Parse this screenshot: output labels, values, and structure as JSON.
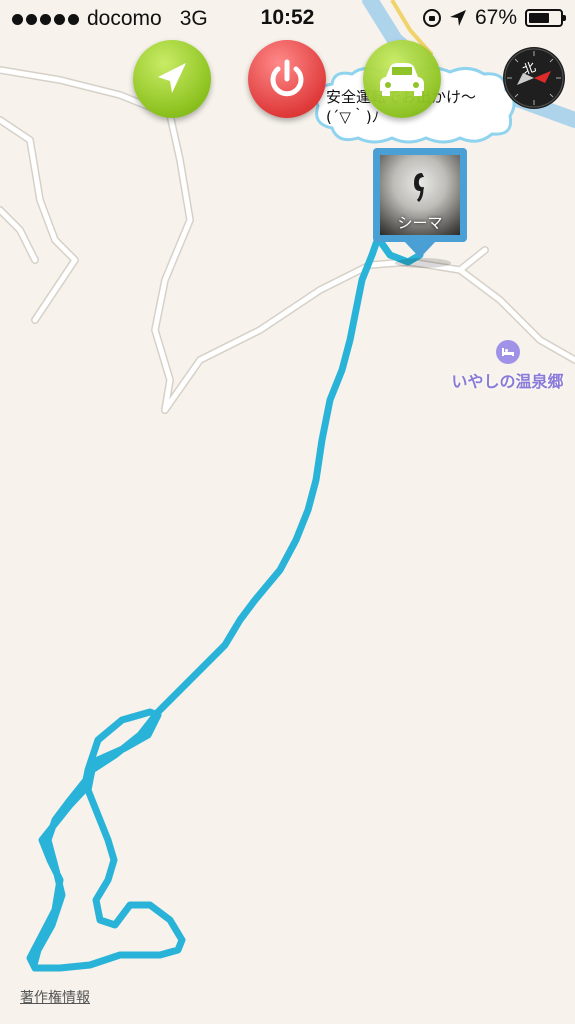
{
  "status_bar": {
    "carrier": "docomo",
    "network": "3G",
    "time": "10:52",
    "battery": "67%",
    "battery_level": 0.67,
    "icons": [
      "signal-dots-icon",
      "rotation-lock-icon",
      "location-arrow-icon",
      "battery-icon"
    ]
  },
  "toolbar": {
    "buttons": [
      {
        "name": "navigate-button",
        "icon": "navigation-arrow-icon",
        "color": "#8cc21f"
      },
      {
        "name": "power-button",
        "icon": "power-icon",
        "color": "#e03c3c"
      },
      {
        "name": "car-button",
        "icon": "car-icon",
        "color": "#8cc21f"
      }
    ],
    "compass": {
      "label": "北",
      "icon": "compass-icon"
    }
  },
  "speech_bubble": {
    "text": "安全運転でお出かけ〜\n(´▽｀)ﾉ"
  },
  "photo_pin": {
    "label": "シーマ",
    "frame_color": "#4a9fd4"
  },
  "poi": {
    "label": "いやしの温泉郷",
    "icon": "bed-icon",
    "color": "#8a7bd8"
  },
  "route": {
    "color": "#2ab3d8"
  },
  "footer": {
    "copyright_link": "著作権情報"
  }
}
